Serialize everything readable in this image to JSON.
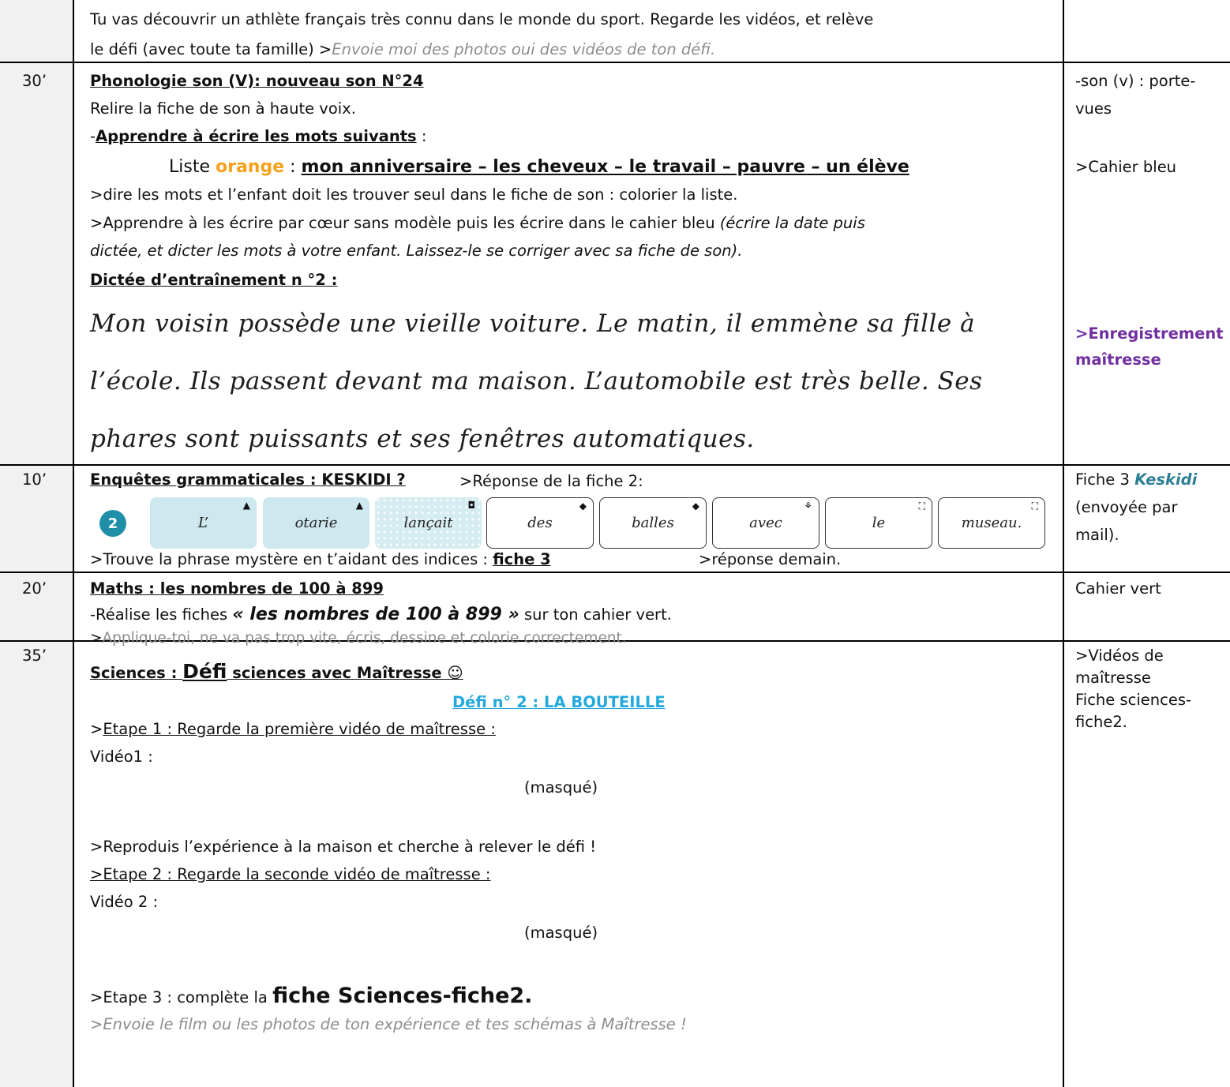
{
  "intro": {
    "line1": "Tu vas découvrir un athlète français très connu dans le monde du sport. Regarde les vidéos, et relève",
    "line2_text": "le défi (avec toute ta famille)  >",
    "line2_note": "Envoie moi des photos oui des vidéos de ton défi."
  },
  "phonologie": {
    "duration": "30’",
    "title": "Phonologie son (V): nouveau son N°24",
    "line1": "Relire la fiche de son à haute voix.",
    "learn_dash": "-",
    "learn_label": "Apprendre à écrire les mots suivants",
    "learn_colon": " :",
    "list_prefix": "Liste ",
    "list_color": "orange",
    "list_sep": " : ",
    "list_words": "mon anniversaire – les cheveux – le travail – pauvre – un élève",
    "instr1": ">dire les mots et l’enfant doit les trouver seul dans le fiche de son : colorier la liste.",
    "instr2_text": ">Apprendre à les écrire par cœur sans modèle puis les écrire dans le cahier bleu ",
    "instr2_italic": "(écrire la date puis",
    "instr3_italic": "dictée, et dicter les mots à votre enfant. Laissez-le se corriger avec sa fiche de son).",
    "dictee_title": "Dictée d’entraînement n °2 :",
    "dictee_line1": "Mon voisin possède une vieille voiture. Le matin, il emmène sa fille à",
    "dictee_line2": "l’école. Ils passent devant ma maison. L’automobile est très belle. Ses",
    "dictee_line3": "phares sont puissants et ses fenêtres automatiques.",
    "side1": "-son (v) : porte-",
    "side2": "vues",
    "side3": ">Cahier bleu",
    "side4": ">Enregistrement",
    "side5": "maîtresse"
  },
  "enquetes": {
    "duration": "10’",
    "title": "Enquêtes grammaticales : KESKIDI ?",
    "answer_label": ">Réponse de la fiche 2:",
    "badge": "2",
    "tiles": [
      {
        "word": "L’",
        "mark": "▲",
        "style": "blue"
      },
      {
        "word": "otarie",
        "mark": "▲",
        "style": "blue"
      },
      {
        "word": "lançait",
        "mark": "◘",
        "style": "dots"
      },
      {
        "word": "des",
        "mark": "◆",
        "style": "white"
      },
      {
        "word": "balles",
        "mark": "◆",
        "style": "white"
      },
      {
        "word": "avec",
        "mark": "⚘",
        "style": "white"
      },
      {
        "word": "le",
        "mark": "⛶",
        "style": "white"
      },
      {
        "word": "museau.",
        "mark": "⛶",
        "style": "white"
      }
    ],
    "find_text": ">Trouve la phrase mystère en t’aidant des indices : ",
    "find_link": "fiche 3",
    "find_after": ">réponse demain.",
    "side_prefix": "Fiche 3 ",
    "side_keskidi": "Keskidi",
    "side2": "(envoyée par",
    "side3": "mail)."
  },
  "maths": {
    "duration": "20’",
    "title": "Maths : les nombres de 100 à 899",
    "line1_a": "-Réalise les fiches  ",
    "line1_b": "« les nombres de 100 à 899 »",
    "line1_c": " sur ton cahier  vert.",
    "line2_a": ">",
    "line2_b": "Applique-toi, ne va pas trop vite, écris, dessine et colorie correctement.",
    "side": "Cahier vert"
  },
  "sciences": {
    "duration": "35’",
    "title_a": "Sciences : ",
    "title_b": "Défi",
    "title_c": " sciences avec Maîtresse ☺",
    "defi": "Défi n° 2 : LA BOUTEILLE",
    "etape1_a": ">",
    "etape1_b": "Etape 1 : Regarde la première vidéo de maîtresse :",
    "video1": "Vidéo1 :",
    "hidden1": "(masqué)",
    "reproduis": ">Reproduis l’expérience à la maison et cherche à relever le défi !",
    "etape2": ">Etape 2 : Regarde la seconde vidéo de maîtresse :",
    "video2": "Vidéo 2 :",
    "hidden2": "(masqué)",
    "etape3_a": ">Etape 3 : complète la ",
    "etape3_b": "fiche Sciences-fiche2.",
    "envoie": ">Envoie le film ou les photos de ton expérience et tes schémas à Maîtresse !",
    "side1": ">Vidéos de",
    "side2": "maîtresse",
    "side3": "Fiche sciences-",
    "side4": "fiche2."
  }
}
